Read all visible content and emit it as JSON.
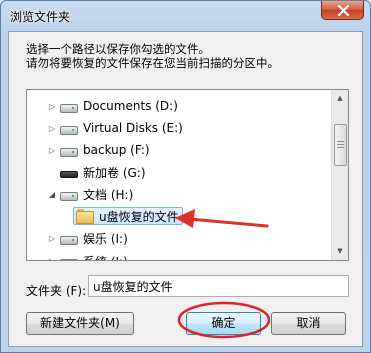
{
  "window": {
    "title": "浏览文件夹"
  },
  "instructions": {
    "line1": "选择一个路径以保存你勾选的文件。",
    "line2": "请勿将要恢复的文件保存在您当前扫描的分区中。"
  },
  "tree": {
    "items": [
      {
        "label": "Documents (D:)",
        "icon": "drive-icon",
        "expander": "▷"
      },
      {
        "label": "Virtual Disks (E:)",
        "icon": "drive-icon",
        "expander": "▷"
      },
      {
        "label": "backup (F:)",
        "icon": "drive-icon",
        "expander": "▷"
      },
      {
        "label": "新加卷 (G:)",
        "icon": "usb-drive-icon",
        "expander": ""
      },
      {
        "label": "文档 (H:)",
        "icon": "drive-icon",
        "expander": "◢"
      },
      {
        "label": "u盘恢复的文件",
        "icon": "folder-icon",
        "expander": "",
        "selected": true
      },
      {
        "label": "娱乐 (I:)",
        "icon": "drive-icon",
        "expander": "▷"
      },
      {
        "label": "系统 (J:)",
        "icon": "drive-icon",
        "expander": "▷"
      }
    ]
  },
  "folder_field": {
    "label": "文件夹 (F):",
    "value": "u盘恢复的文件"
  },
  "buttons": {
    "new_folder": "新建文件夹(M)",
    "ok": "确定",
    "cancel": "取消"
  },
  "annotation_colors": {
    "arrow": "#e0302a",
    "circle": "#d9262a"
  }
}
